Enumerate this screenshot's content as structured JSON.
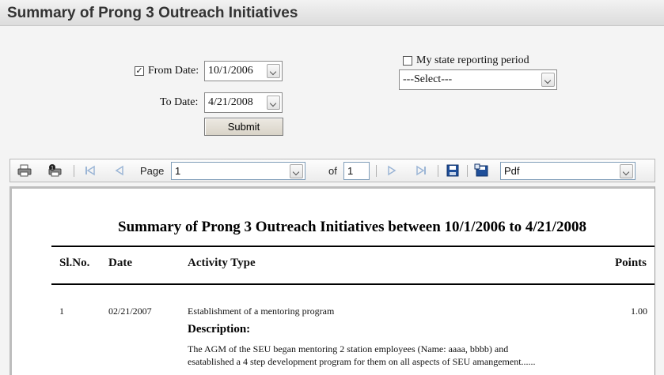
{
  "page": {
    "title": "Summary of Prong 3 Outreach Initiatives"
  },
  "filters": {
    "from_checked": "✓",
    "from_label": "From Date:",
    "from_value": "10/1/2006",
    "to_label": "To Date:",
    "to_value": "4/21/2008",
    "submit_label": "Submit",
    "state_label": "My state reporting period",
    "state_select": "---Select---"
  },
  "toolbar": {
    "page_label": "Page",
    "page_select": "1",
    "of_label": "of",
    "total_pages": "1",
    "format_select": "Pdf"
  },
  "report": {
    "title": "Summary of Prong 3 Outreach Initiatives between 10/1/2006 to 4/21/2008",
    "columns": {
      "slno": "Sl.No.",
      "date": "Date",
      "activity": "Activity Type",
      "points": "Points"
    },
    "rows": [
      {
        "slno": "1",
        "date": "02/21/2007",
        "activity": "Establishment of a mentoring program",
        "points": "1.00",
        "desc_heading": "Description:",
        "desc_line1": "The AGM of the SEU began mentoring 2 station employees (Name: aaaa, bbbb) and",
        "desc_line2": "esatablished a 4 step development program for them on all aspects of SEU amangement......"
      }
    ]
  }
}
